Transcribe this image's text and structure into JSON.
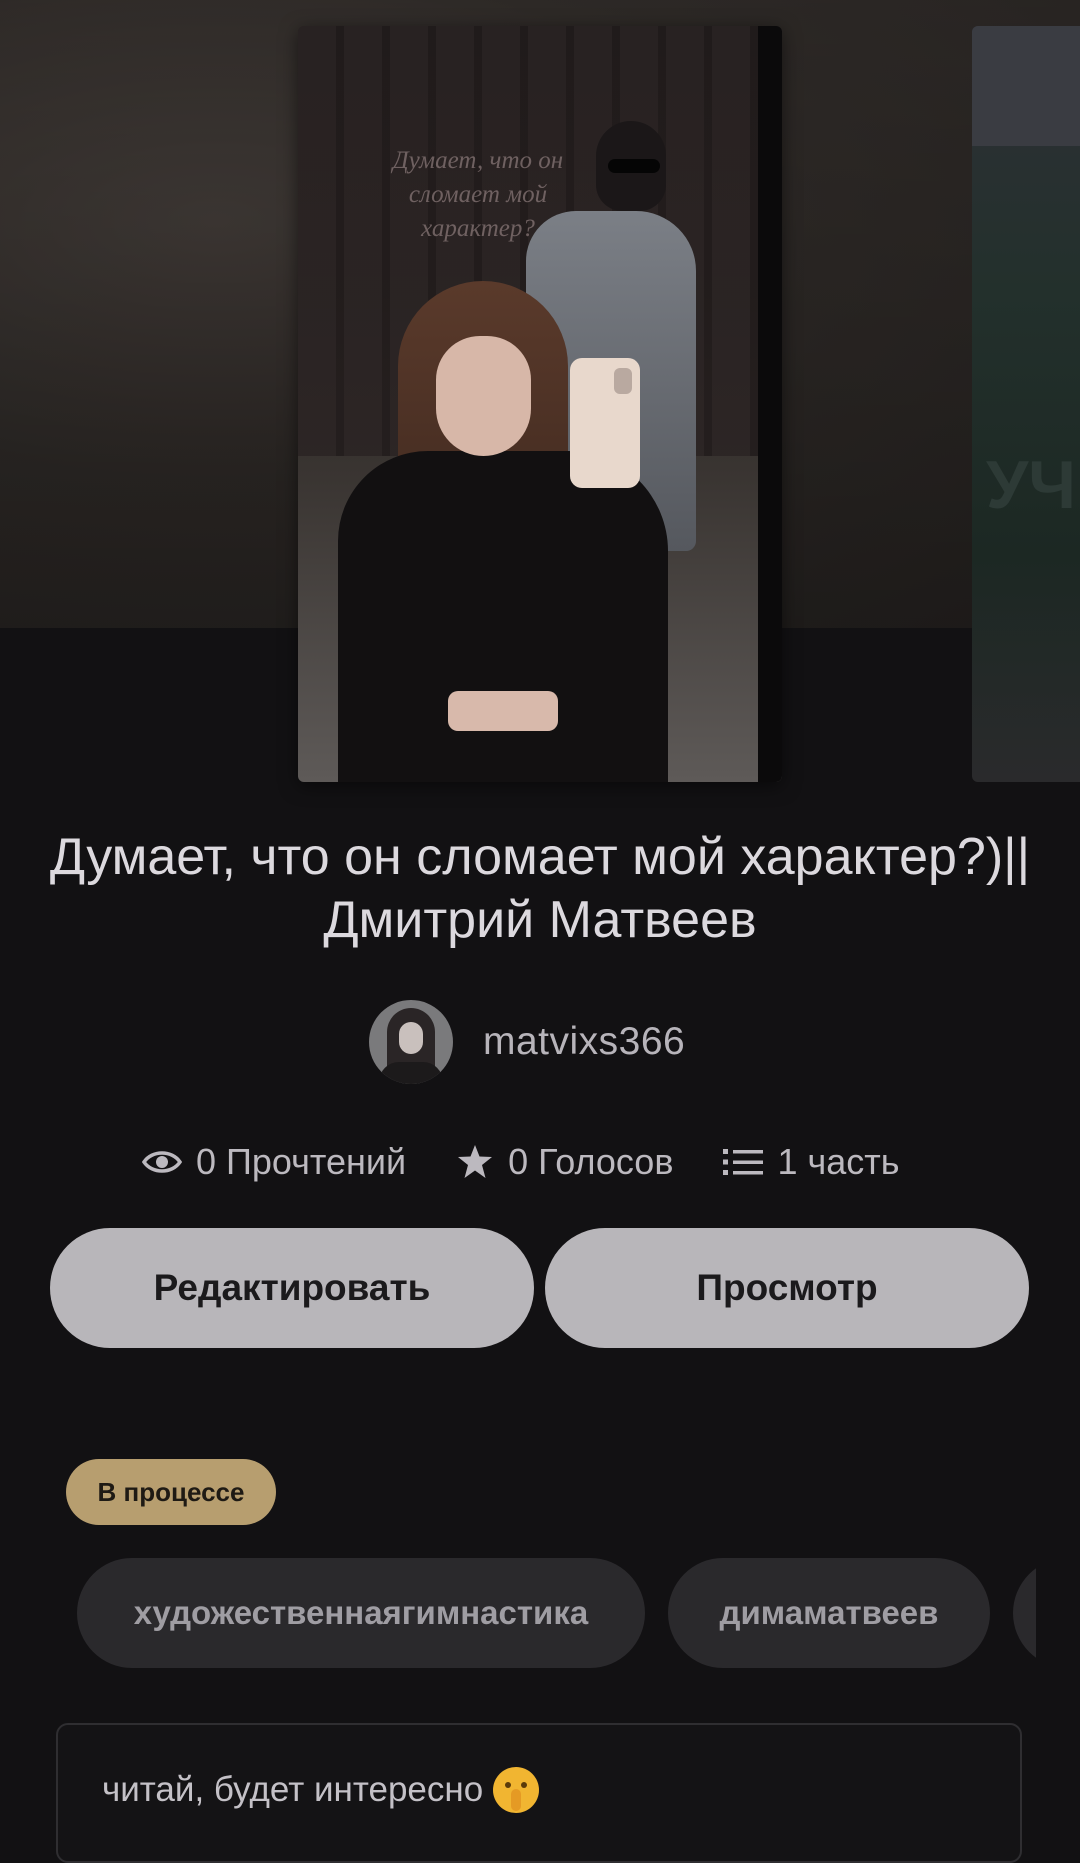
{
  "story": {
    "cover_overlay_text": "Думает, что он сломает мой характер?",
    "title": "Думает, что он сломает мой характер?)|| Дмитрий Матвеев",
    "author": "matvixs366",
    "side_cover_text": "УЧ"
  },
  "stats": {
    "reads": "0 Прочтений",
    "votes": "0 Голосов",
    "parts": "1 часть"
  },
  "actions": {
    "edit_label": "Редактировать",
    "view_label": "Просмотр"
  },
  "status": "В процессе",
  "tags": [
    "художественнаягимнастика",
    "димаматвеев",
    ""
  ],
  "description": "читай, будет интересно",
  "icons": {
    "reads": "eye-icon",
    "votes": "star-icon",
    "parts": "list-icon",
    "description_emoji": "shushing-face-emoji"
  },
  "colors": {
    "background": "#121113",
    "button": "#b8b6ba",
    "status_badge": "#b79e6f",
    "tag": "#2a292c"
  }
}
